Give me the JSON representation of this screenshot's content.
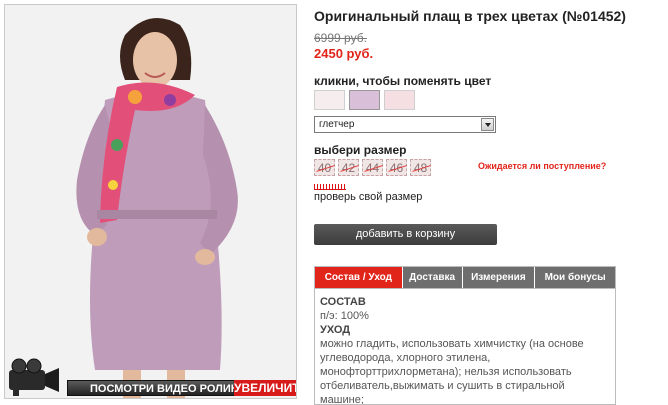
{
  "product": {
    "title": "Оригинальный плащ в трех цветах (№01452)",
    "old_price": "6999 руб.",
    "new_price": "2450 руб."
  },
  "color": {
    "label": "кликни, чтобы поменять цвет",
    "swatches": [
      "#f6eeee",
      "#d9bfd8",
      "#f6dfe3"
    ],
    "selected_value": "глетчер"
  },
  "size": {
    "label": "выбери размер",
    "options": [
      "40",
      "42",
      "44",
      "46",
      "48"
    ],
    "notify_link": "Ожидается ли поступление?",
    "check_link": "проверь свой размер"
  },
  "cart": {
    "add_label": "добавить в корзину"
  },
  "media": {
    "video_label": "посмотри видео ролик",
    "zoom_label": "увеличить"
  },
  "tabs": {
    "items": [
      "Состав / Уход",
      "Доставка",
      "Измерения",
      "Мои бонусы"
    ],
    "active": 0,
    "content": {
      "composition_heading": "СОСТАВ",
      "composition_value": "п/э: 100%",
      "care_heading": "УХОД",
      "care_text": "можно гладить, использовать химчистку (на основе углеводорода, хлорного этилена, монофторттрихлорметана); нельзя использовать отбеливатель,выжимать и сушить в стиральной машине;"
    }
  },
  "colors": {
    "accent": "#e1251b",
    "tab_inactive": "#6e6e6e",
    "button_dark": "#4a4a4a"
  }
}
